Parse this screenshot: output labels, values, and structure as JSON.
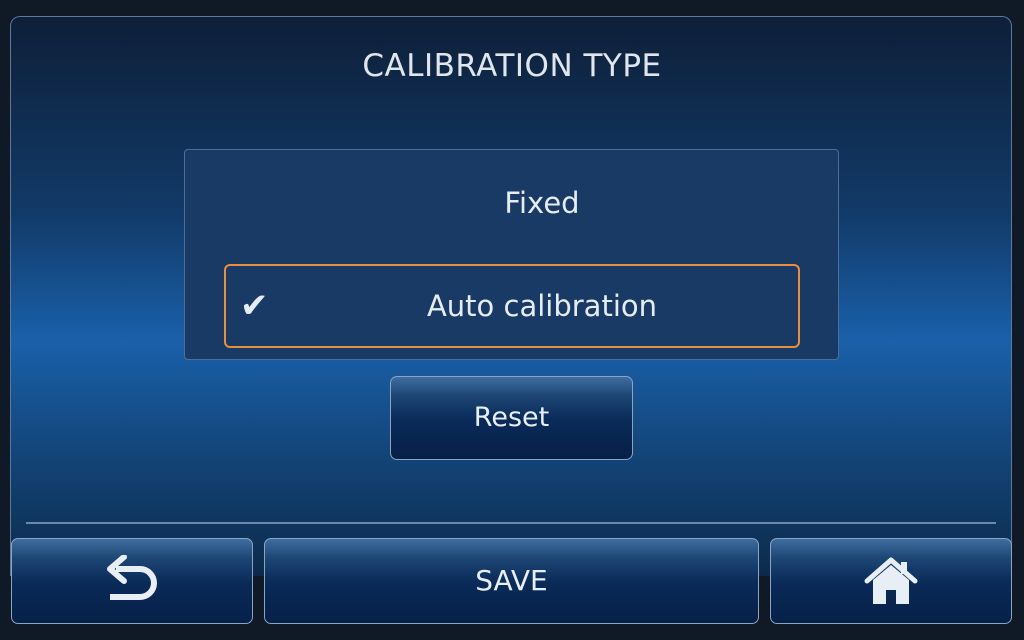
{
  "screen": {
    "title": "CALIBRATION TYPE"
  },
  "options": {
    "fixed_label": "Fixed",
    "auto_label": "Auto calibration",
    "selected": "Auto calibration",
    "check_glyph": "✔"
  },
  "buttons": {
    "reset_label": "Reset",
    "save_label": "SAVE",
    "back_icon": "back-arrow-icon",
    "home_icon": "home-icon"
  },
  "colors": {
    "selection_border": "#e88f3d",
    "accent_blue": "#1a60aa"
  }
}
